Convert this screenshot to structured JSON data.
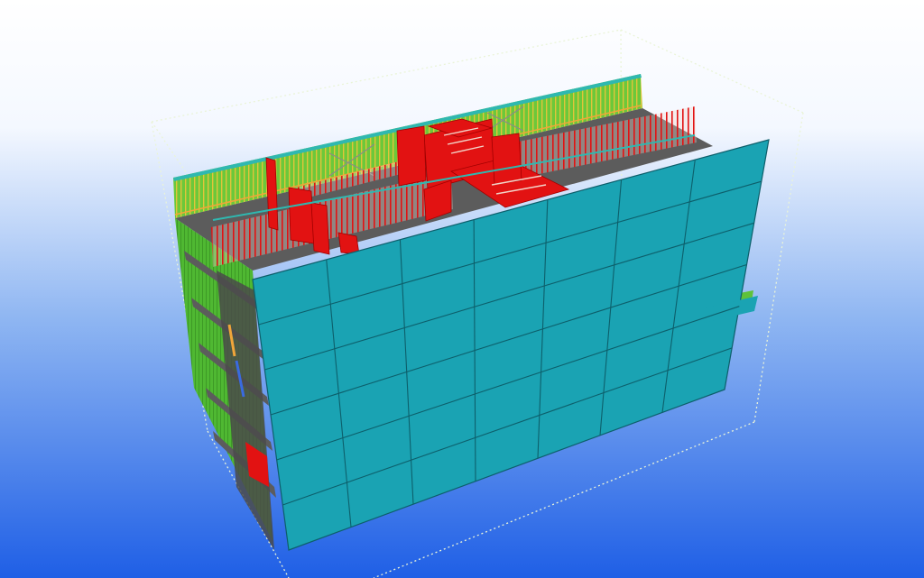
{
  "viewport": {
    "background_top": "#ffffff",
    "background_bottom": "#1f5fe6"
  },
  "model": {
    "facade_color": "#1aa3b3",
    "facade_grid_color": "#0d5f6b",
    "slab_color": "#5c5c5c",
    "wall_red": "#e21212",
    "wall_green": "#5fc23a",
    "rail_yellow": "#e0c53a",
    "accent_orange": "#f0a53a",
    "bbox_line_color": "#eaf4d8",
    "storeys": 6,
    "facade_columns": 7
  }
}
